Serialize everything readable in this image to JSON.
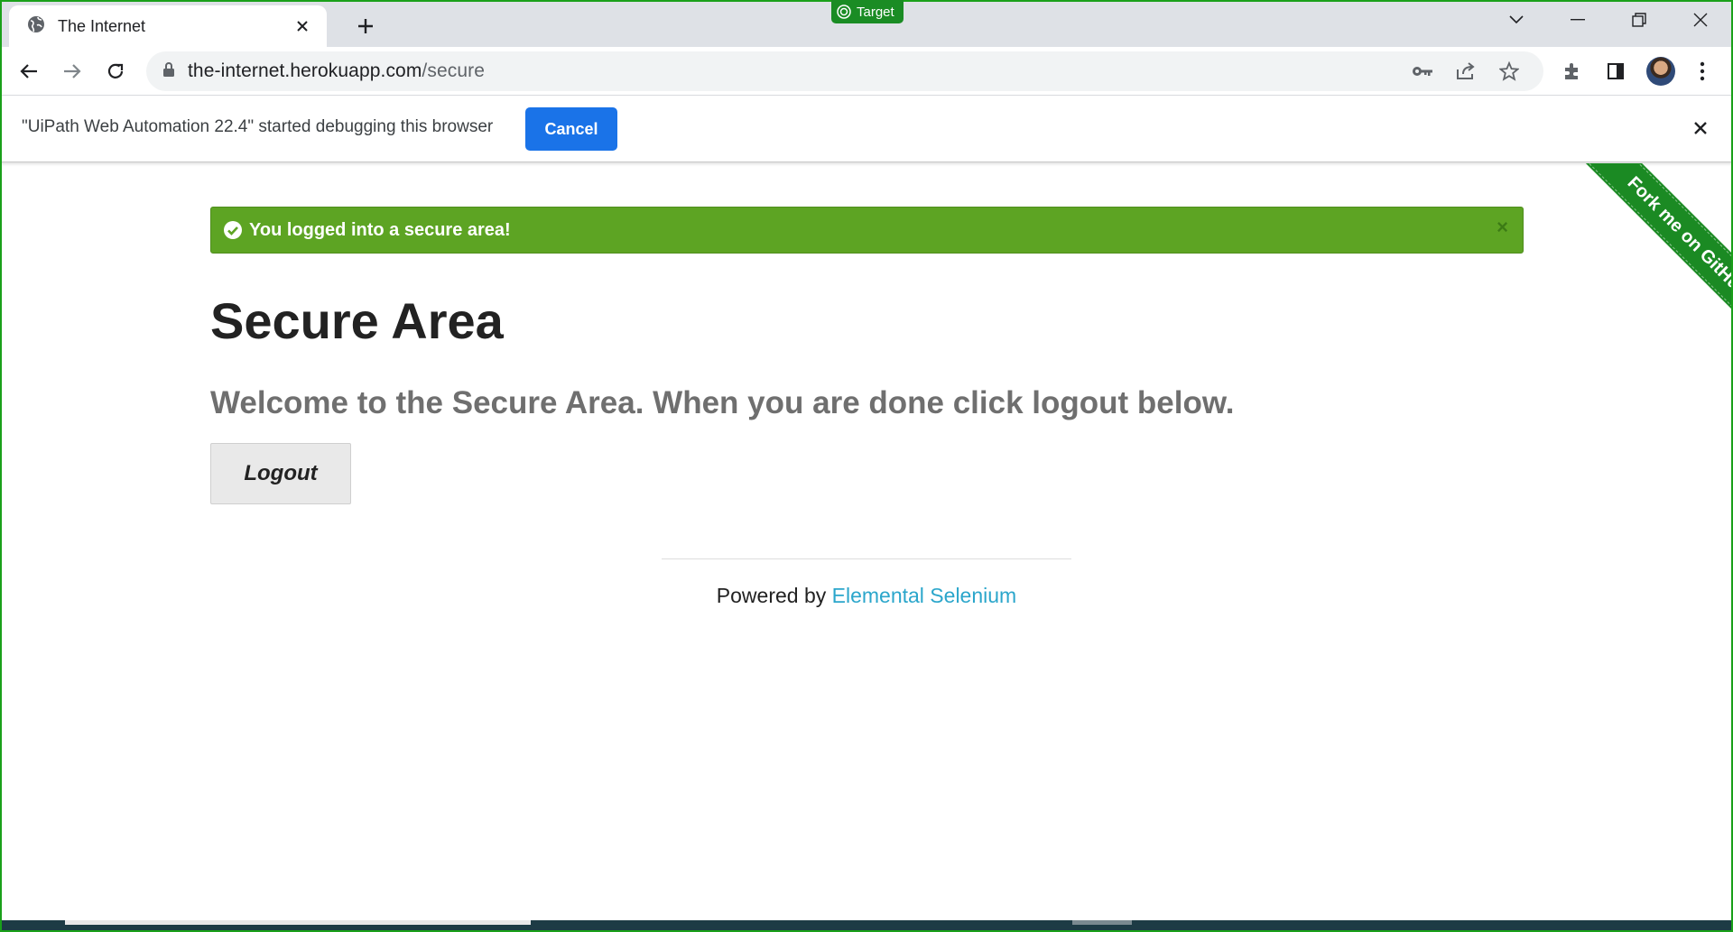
{
  "browser": {
    "tab_title": "The Internet",
    "url_host": "the-internet.herokuapp.com",
    "url_path": "/secure",
    "target_badge": "Target"
  },
  "infobar": {
    "message": "\"UiPath Web Automation 22.4\" started debugging this browser",
    "cancel_label": "Cancel"
  },
  "page": {
    "flash_message": "You logged into a secure area!",
    "flash_close": "×",
    "heading": "Secure Area",
    "subheader": "Welcome to the Secure Area. When you are done click logout below.",
    "logout_label": "Logout",
    "footer_prefix": "Powered by ",
    "footer_link": "Elemental Selenium",
    "ribbon": "Fork me on GitHub"
  },
  "colors": {
    "flash_success": "#5da423",
    "link": "#2ba6cb",
    "ribbon": "#1b8a23",
    "cancel_button": "#1a73e8"
  }
}
